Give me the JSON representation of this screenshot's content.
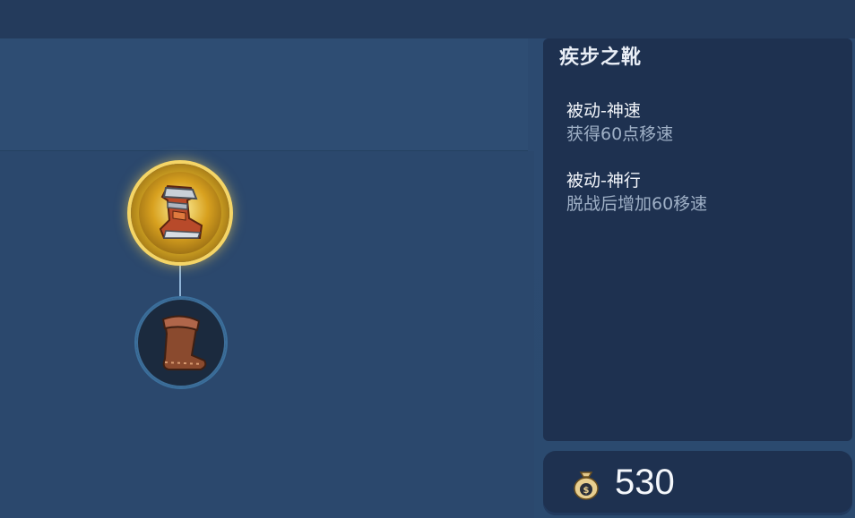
{
  "item": {
    "name": "疾步之靴",
    "passives": [
      {
        "title": "被动-神速",
        "desc": "获得60点移速"
      },
      {
        "title": "被动-神行",
        "desc": "脱战后增加60移速"
      }
    ]
  },
  "price": {
    "value": "530",
    "icon": "gold-bag-icon"
  },
  "tree": {
    "top_node": {
      "icon": "armored-boots-icon",
      "selected": true
    },
    "bottom_node": {
      "icon": "leather-boots-icon",
      "selected": false
    }
  },
  "colors": {
    "background": "#2b486d",
    "panel": "#1e3150",
    "selected_ring": "#f5d566",
    "connector": "#8fb3d6"
  }
}
